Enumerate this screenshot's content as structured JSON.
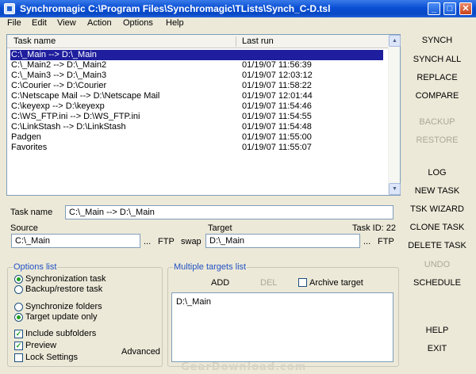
{
  "window": {
    "title": "Synchromagic C:\\Program Files\\Synchromagic\\TLists\\Synch_C-D.tsl",
    "controls": [
      "_",
      "□",
      "✕"
    ]
  },
  "menu": [
    "File",
    "Edit",
    "View",
    "Action",
    "Options",
    "Help"
  ],
  "tasklist": {
    "columns": [
      "Task name",
      "Last run"
    ],
    "rows": [
      {
        "task": "C:\\_Main -->  D:\\_Main",
        "last_run": ""
      },
      {
        "task": "C:\\_Main2 -->  D:\\_Main2",
        "last_run": "01/19/07 11:56:39"
      },
      {
        "task": "C:\\_Main3 -->  D:\\_Main3",
        "last_run": "01/19/07 12:03:12"
      },
      {
        "task": "C:\\Courier -->  D:\\Courier",
        "last_run": "01/19/07 11:58:22"
      },
      {
        "task": "C:\\Netscape Mail --> D:\\Netscape Mail",
        "last_run": "01/19/07 12:01:44"
      },
      {
        "task": "C:\\keyexp --> D:\\keyexp",
        "last_run": "01/19/07 11:54:46"
      },
      {
        "task": "C:\\WS_FTP.ini --> D:\\WS_FTP.ini",
        "last_run": "01/19/07 11:54:55"
      },
      {
        "task": "C:\\LinkStash --> D:\\LinkStash",
        "last_run": "01/19/07 11:54:48"
      },
      {
        "task": "Padgen",
        "last_run": "01/19/07 11:55:00"
      },
      {
        "task": "Favorites",
        "last_run": "01/19/07 11:55:07"
      }
    ]
  },
  "task": {
    "name_label": "Task name",
    "name_value": "C:\\_Main -->  D:\\_Main",
    "source_label": "Source",
    "source_value": "C:\\_Main",
    "target_label": "Target",
    "target_value": "D:\\_Main",
    "task_id": "Task ID: 22",
    "browse": "...",
    "ftp": "FTP",
    "swap": "swap"
  },
  "options": {
    "title": "Options list",
    "synchronization_task": "Synchronization task",
    "backup_restore_task": "Backup/restore task",
    "synchronize_folders": "Synchronize folders",
    "target_update_only": "Target update only",
    "include_subfolders": "Include subfolders",
    "preview": "Preview",
    "lock_settings": "Lock Settings",
    "advanced": "Advanced"
  },
  "multiple_targets": {
    "title": "Multiple targets list",
    "add": "ADD",
    "del": "DEL",
    "archive_target": "Archive target",
    "items": [
      "D:\\_Main"
    ]
  },
  "sidebar": {
    "synch": "SYNCH",
    "synch_all": "SYNCH ALL",
    "replace": "REPLACE",
    "compare": "COMPARE",
    "backup": "BACKUP",
    "restore": "RESTORE",
    "log": "LOG",
    "new_task": "NEW TASK",
    "tsk_wizard": "TSK WIZARD",
    "clone_task": "CLONE TASK",
    "delete_task": "DELETE TASK",
    "undo": "UNDO",
    "schedule": "SCHEDULE",
    "help": "HELP",
    "exit": "EXIT"
  },
  "watermark": "GearDownload.com",
  "colors": {
    "titlebar": "#0a4fd4",
    "selection": "#1e1e9e",
    "group_title": "#2151c5",
    "disabled": "#aca899"
  }
}
